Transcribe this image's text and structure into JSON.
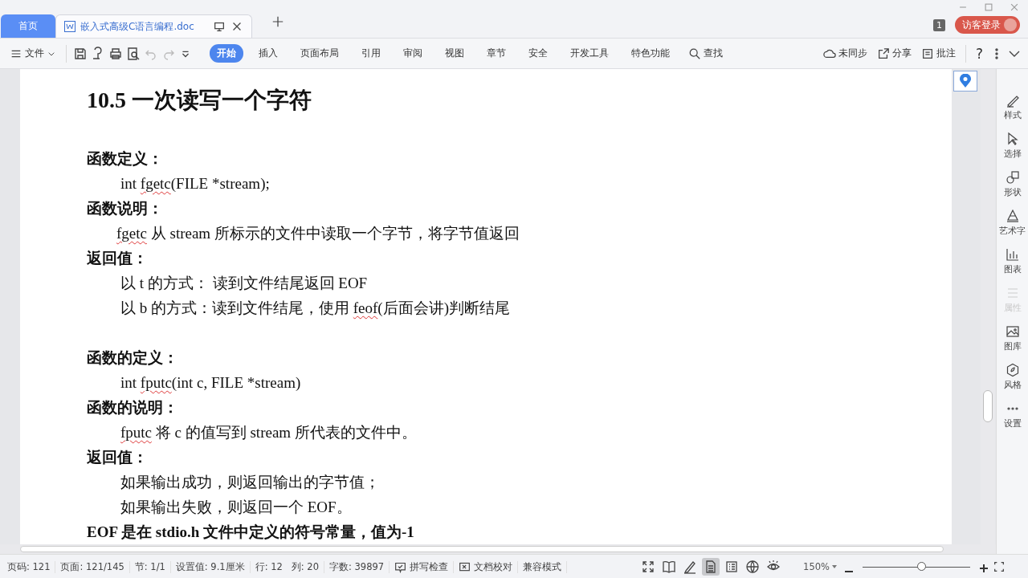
{
  "tabs": [
    {
      "kind": "home",
      "label": "首页",
      "selected": false
    },
    {
      "kind": "doc",
      "label": "嵌入式高级C语言编程.doc",
      "selected": true
    }
  ],
  "window": {
    "page_count": "1",
    "login": "访客登录"
  },
  "toolbar": {
    "file_menu": "文件",
    "ribbon_tabs": [
      {
        "label": "开始",
        "selected": true
      },
      {
        "label": "插入",
        "selected": false
      },
      {
        "label": "页面布局",
        "selected": false
      },
      {
        "label": "引用",
        "selected": false
      },
      {
        "label": "审阅",
        "selected": false
      },
      {
        "label": "视图",
        "selected": false
      },
      {
        "label": "章节",
        "selected": false
      },
      {
        "label": "安全",
        "selected": false
      },
      {
        "label": "开发工具",
        "selected": false
      },
      {
        "label": "特色功能",
        "selected": false
      }
    ],
    "search": "查找",
    "sync": "未同步",
    "share": "分享",
    "comment": "批注",
    "help": "?"
  },
  "document": {
    "heading": "10.5  一次读写一个字符",
    "lines": [
      {
        "kind": "label",
        "parts": [
          {
            "text": "函数定义："
          }
        ]
      },
      {
        "kind": "code",
        "parts": [
          {
            "text": "int "
          },
          {
            "text": "fgetc",
            "misspelled": true
          },
          {
            "text": "(FILE *stream);"
          }
        ]
      },
      {
        "kind": "label",
        "parts": [
          {
            "text": "函数说明："
          }
        ]
      },
      {
        "kind": "text",
        "parts": [
          {
            "text": "fgetc",
            "misspelled": true
          },
          {
            "text": " 从 stream 所标示的文件中读取一个字节，将字节值返回"
          }
        ]
      },
      {
        "kind": "label",
        "parts": [
          {
            "text": "返回值："
          }
        ]
      },
      {
        "kind": "code",
        "parts": [
          {
            "text": "以 t 的方式：    读到文件结尾返回 EOF"
          }
        ]
      },
      {
        "kind": "code",
        "parts": [
          {
            "text": "以 b 的方式：读到文件结尾，使用 "
          },
          {
            "text": "feof",
            "misspelled": true
          },
          {
            "text": "(后面会讲)判断结尾"
          }
        ]
      },
      {
        "kind": "blank"
      },
      {
        "kind": "label",
        "parts": [
          {
            "text": "函数的定义："
          }
        ]
      },
      {
        "kind": "code",
        "parts": [
          {
            "text": "int "
          },
          {
            "text": "fputc",
            "misspelled": true
          },
          {
            "text": "(int c, FILE *stream)"
          }
        ]
      },
      {
        "kind": "label",
        "parts": [
          {
            "text": "函数的说明："
          }
        ]
      },
      {
        "kind": "code",
        "parts": [
          {
            "text": "fputc",
            "misspelled": true
          },
          {
            "text": " 将 c 的值写到 stream 所代表的文件中。"
          }
        ]
      },
      {
        "kind": "label",
        "parts": [
          {
            "text": "返回值："
          }
        ]
      },
      {
        "kind": "code",
        "parts": [
          {
            "text": "如果输出成功，则返回输出的字节值；"
          }
        ]
      },
      {
        "kind": "code",
        "parts": [
          {
            "text": "如果输出失败，则返回一个 EOF。"
          }
        ]
      },
      {
        "kind": "label",
        "parts": [
          {
            "text": "EOF 是在 stdio.h 文件中定义的符号常量，值为-1"
          }
        ]
      }
    ]
  },
  "sidebar": {
    "items": [
      {
        "label": "样式",
        "disabled": false
      },
      {
        "label": "选择",
        "disabled": false
      },
      {
        "label": "形状",
        "disabled": false
      },
      {
        "label": "艺术字",
        "disabled": false
      },
      {
        "label": "图表",
        "disabled": false
      },
      {
        "label": "属性",
        "disabled": true
      },
      {
        "label": "图库",
        "disabled": false
      },
      {
        "label": "风格",
        "disabled": false
      },
      {
        "label": "设置",
        "disabled": false
      }
    ]
  },
  "status_bar": {
    "items": [
      {
        "kind": "text",
        "label": "页码: 121"
      },
      {
        "kind": "text",
        "label": "页面: 121/145"
      },
      {
        "kind": "text",
        "label": "节: 1/1"
      },
      {
        "kind": "text",
        "label": "设置值: 9.1厘米"
      },
      {
        "kind": "text",
        "label": "行: 12   列: 20"
      },
      {
        "kind": "text",
        "label": "字数: 39897"
      },
      {
        "kind": "spell",
        "label": "拼写检查"
      },
      {
        "kind": "check",
        "label": "文档校对"
      },
      {
        "kind": "text",
        "label": "兼容模式"
      }
    ],
    "views": [
      {
        "selected": false
      },
      {
        "selected": false
      },
      {
        "selected": false
      },
      {
        "selected": true
      },
      {
        "selected": false
      },
      {
        "selected": false
      },
      {
        "selected": false
      }
    ],
    "zoom": "150%",
    "zoom_slider": {
      "level": 0.55
    }
  }
}
